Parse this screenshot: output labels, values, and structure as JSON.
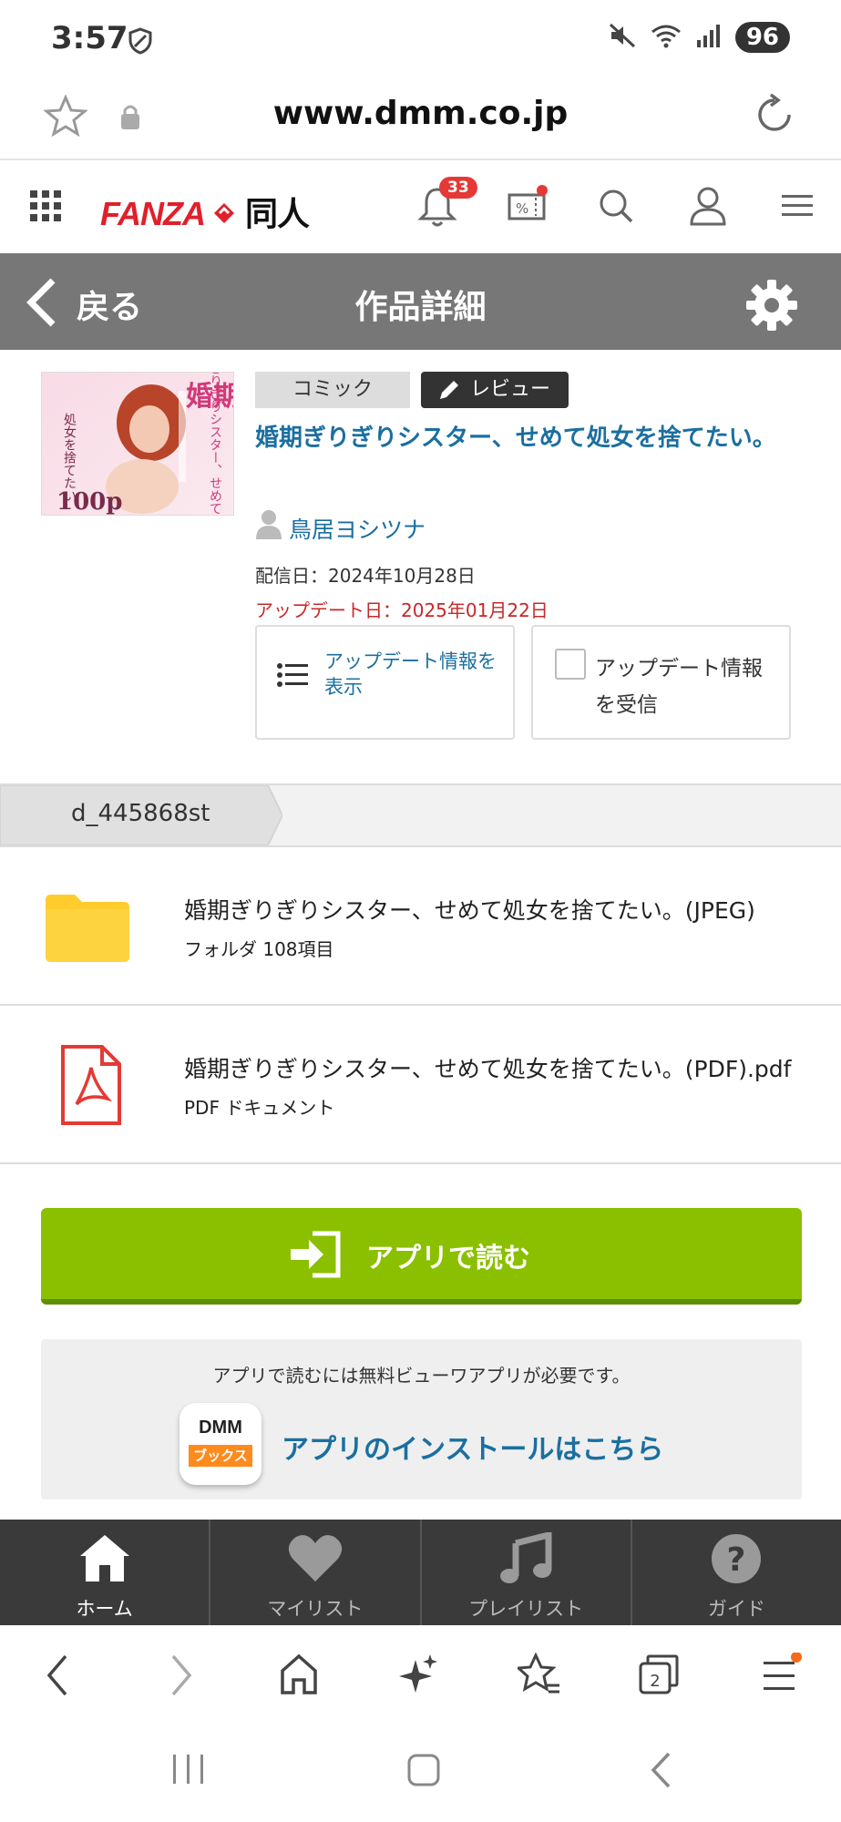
{
  "status": {
    "time": "3:57",
    "battery": "96"
  },
  "browser": {
    "url": "www.dmm.co.jp"
  },
  "header": {
    "logo_main": "FANZA",
    "logo_sub": "同人",
    "notification_count": "33"
  },
  "navbar": {
    "back_label": "戻る",
    "title": "作品詳細"
  },
  "product": {
    "tag_comic": "コミック",
    "tag_review": "レビュー",
    "title": "婚期ぎりぎりシスター、せめて処女を捨てたい。",
    "author": "鳥居ヨシツナ",
    "distribution_date": "配信日：2024年10月28日",
    "update_date": "アップデート日：2025年01月22日",
    "update_info_button": "アップデート情報を表示",
    "receive_updates_label": "アップデート情報を受信",
    "cover": {
      "title_big": "婚期",
      "title_side": "ぎりぎりシスター、せめて",
      "title_left": "処女を捨てたい",
      "pages": "100p"
    }
  },
  "product_id": "d_445868st",
  "files": [
    {
      "name": "婚期ぎりぎりシスター、せめて処女を捨てたい。(JPEG)",
      "detail": "フォルダ 108項目",
      "icon": "folder-icon"
    },
    {
      "name": "婚期ぎりぎりシスター、せめて処女を捨てたい。(PDF).pdf",
      "detail": "PDF ドキュメント",
      "icon": "pdf-icon"
    }
  ],
  "read_button": "アプリで読む",
  "install": {
    "note": "アプリで読むには無料ビューワアプリが必要です。",
    "link": "アプリのインストールはこちら",
    "app_icon_top": "DMM",
    "app_icon_bottom": "ブックス"
  },
  "site_nav": [
    {
      "label": "ホーム",
      "icon": "home-icon"
    },
    {
      "label": "マイリスト",
      "icon": "heart-icon"
    },
    {
      "label": "プレイリスト",
      "icon": "music-icon"
    },
    {
      "label": "ガイド",
      "icon": "help-icon"
    }
  ],
  "browser_toolbar": {
    "tabs_count": "2"
  },
  "colors": {
    "accent_blue": "#1a6fa0",
    "brand_red": "#e0202a",
    "read_green": "#8bc000",
    "update_red": "#c62828",
    "navbar_gray": "#777777"
  }
}
